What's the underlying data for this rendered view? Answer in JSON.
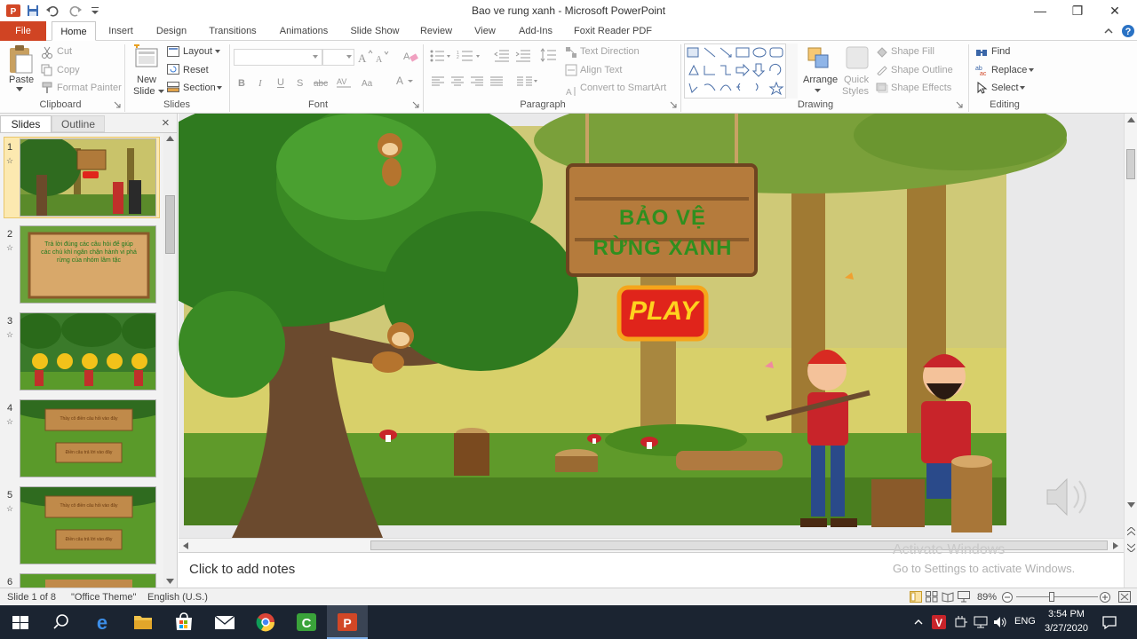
{
  "window": {
    "title": "Bao ve rung xanh  -  Microsoft PowerPoint",
    "minimize": "—",
    "maximize": "❐",
    "close": "✕"
  },
  "tabs": [
    "File",
    "Home",
    "Insert",
    "Design",
    "Transitions",
    "Animations",
    "Slide Show",
    "Review",
    "View",
    "Add-Ins",
    "Foxit Reader PDF"
  ],
  "ribbon": {
    "clipboard": {
      "label": "Clipboard",
      "paste": "Paste",
      "cut": "Cut",
      "copy": "Copy",
      "format_painter": "Format Painter"
    },
    "slides": {
      "label": "Slides",
      "new_slide_1": "New",
      "new_slide_2": "Slide",
      "layout": "Layout",
      "reset": "Reset",
      "section": "Section"
    },
    "font": {
      "label": "Font"
    },
    "paragraph": {
      "label": "Paragraph",
      "text_direction": "Text Direction",
      "align_text": "Align Text",
      "convert_smartart": "Convert to SmartArt"
    },
    "drawing": {
      "label": "Drawing",
      "arrange": "Arrange",
      "quick_styles_1": "Quick",
      "quick_styles_2": "Styles",
      "shape_fill": "Shape Fill",
      "shape_outline": "Shape Outline",
      "shape_effects": "Shape Effects"
    },
    "editing": {
      "label": "Editing",
      "find": "Find",
      "replace": "Replace",
      "select": "Select"
    }
  },
  "left_pane": {
    "tab_slides": "Slides",
    "tab_outline": "Outline",
    "close": "×",
    "thumbnails": [
      {
        "num": "1",
        "kind": "title"
      },
      {
        "num": "2",
        "kind": "text",
        "text": "Trả lời đúng các câu hỏi để giúp các chú khỉ ngăn chặn hành vi phá rừng của nhóm lâm tặc"
      },
      {
        "num": "3",
        "kind": "forest"
      },
      {
        "num": "4",
        "kind": "signs",
        "line1": "Thầy cô điền câu hỏi vào đây",
        "line2": "Điền câu trả lời vào đây"
      },
      {
        "num": "5",
        "kind": "signs",
        "line1": "Thầy cô điền câu hỏi vào đây",
        "line2": "Điền câu trả lời vào đây"
      },
      {
        "num": "6",
        "kind": "partial"
      }
    ]
  },
  "slide": {
    "title_line1": "BẢO VỆ",
    "title_line2": "RỪNG XANH",
    "play": "PLAY"
  },
  "notes_placeholder": "Click to add notes",
  "watermark": {
    "line1": "Activate Windows",
    "line2": "Go to Settings to activate Windows."
  },
  "status": {
    "slide": "Slide 1 of 8",
    "theme": "\"Office Theme\"",
    "language": "English (U.S.)",
    "zoom": "89%"
  },
  "tray": {
    "lang": "ENG",
    "time": "3:54 PM",
    "date": "3/27/2020"
  },
  "colors": {
    "file_tab": "#d04423",
    "taskbar": "#1b2431",
    "title_green": "#2f8f1f",
    "play_red": "#e0241b",
    "play_yellow": "#ffd21f"
  }
}
